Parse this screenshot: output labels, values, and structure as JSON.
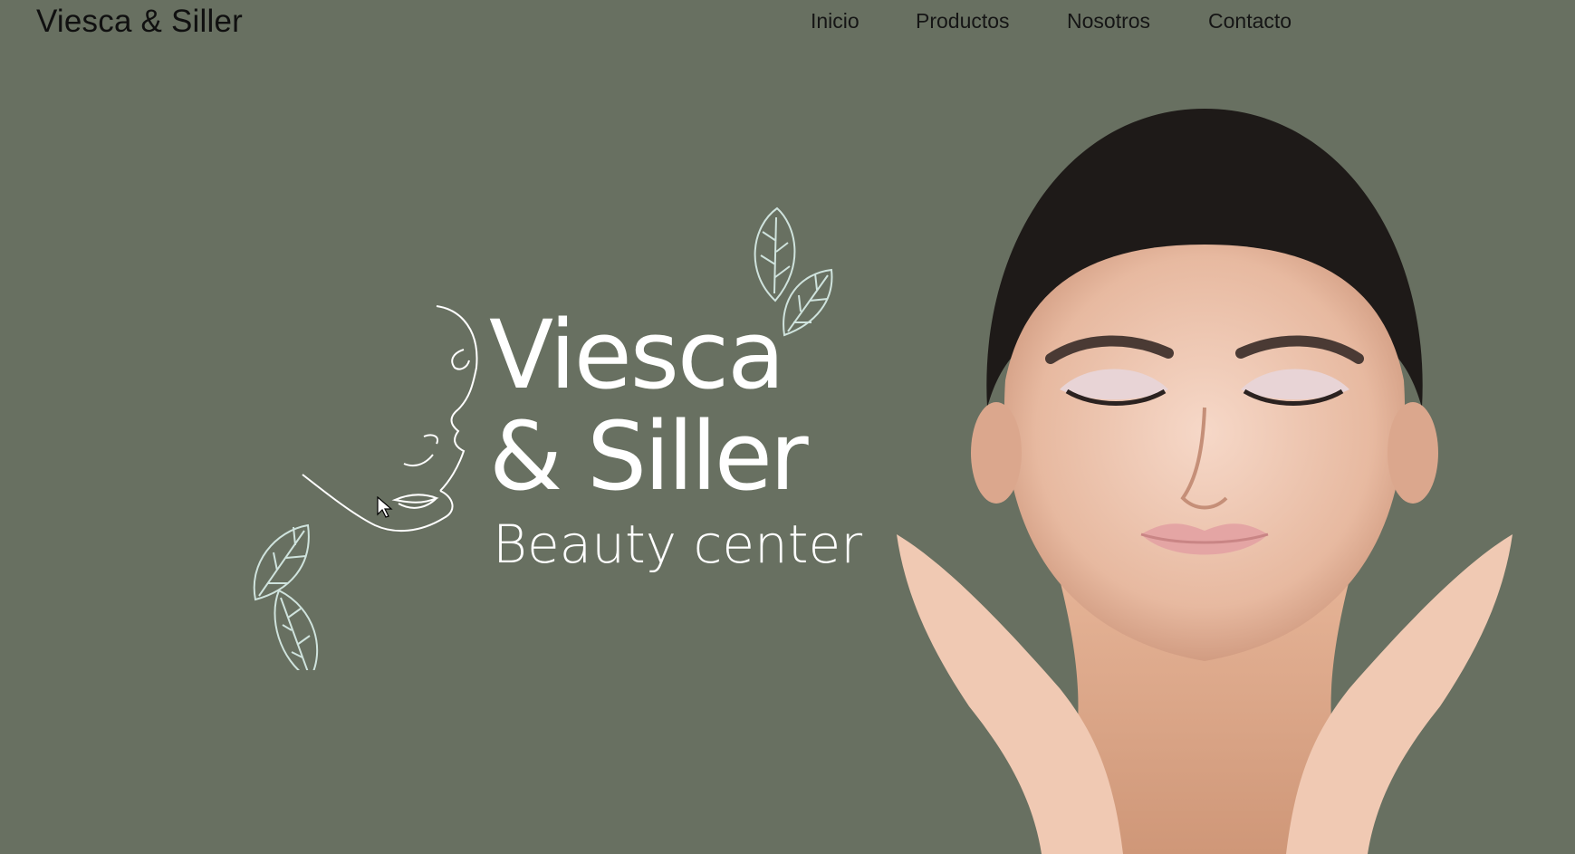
{
  "header": {
    "brand": "Viesca & Siller",
    "nav": [
      {
        "label": "Inicio"
      },
      {
        "label": "Productos"
      },
      {
        "label": "Nosotros"
      },
      {
        "label": "Contacto"
      }
    ]
  },
  "hero": {
    "logo_line1": "Viesca",
    "logo_line2": "& Siller",
    "logo_line3": "Beauty center"
  },
  "colors": {
    "background": "#687061",
    "leaf_stroke": "#cfe3dd",
    "logo_text": "#ffffff",
    "nav_text": "#151515"
  },
  "icons": {
    "leaf_top": "leaf-icon",
    "leaf_bottom": "leaf-icon",
    "face_outline": "face-line-art-icon",
    "cursor": "mouse-pointer-icon"
  }
}
